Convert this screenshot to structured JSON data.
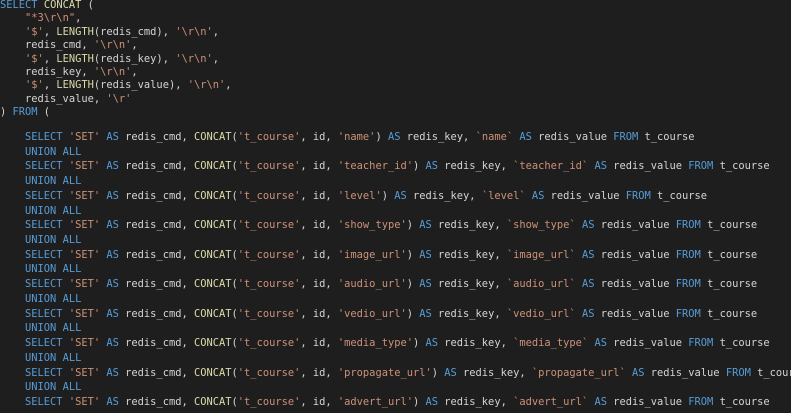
{
  "editor": {
    "language": "sql",
    "colors": {
      "background": "#1e1e1e",
      "keyword": "#569cd6",
      "function": "#dcdcaa",
      "string": "#ce9178",
      "identifier": "#d4d4d4"
    },
    "lines": [
      [
        [
          "kw",
          "SELECT"
        ],
        [
          "pn",
          " "
        ],
        [
          "fn",
          "CONCAT"
        ],
        [
          "pn",
          " ("
        ]
      ],
      [
        [
          "pn",
          "    "
        ],
        [
          "str",
          "\"*3\\r\\n\""
        ],
        [
          "pn",
          ","
        ]
      ],
      [
        [
          "pn",
          "    "
        ],
        [
          "str",
          "'$'"
        ],
        [
          "pn",
          ", "
        ],
        [
          "fn",
          "LENGTH"
        ],
        [
          "pn",
          "(redis_cmd), "
        ],
        [
          "str",
          "'\\r\\n'"
        ],
        [
          "pn",
          ","
        ]
      ],
      [
        [
          "pn",
          "    redis_cmd, "
        ],
        [
          "str",
          "'\\r\\n'"
        ],
        [
          "pn",
          ","
        ]
      ],
      [
        [
          "pn",
          "    "
        ],
        [
          "str",
          "'$'"
        ],
        [
          "pn",
          ", "
        ],
        [
          "fn",
          "LENGTH"
        ],
        [
          "pn",
          "(redis_key), "
        ],
        [
          "str",
          "'\\r\\n'"
        ],
        [
          "pn",
          ","
        ]
      ],
      [
        [
          "pn",
          "    redis_key, "
        ],
        [
          "str",
          "'\\r\\n'"
        ],
        [
          "pn",
          ","
        ]
      ],
      [
        [
          "pn",
          "    "
        ],
        [
          "str",
          "'$'"
        ],
        [
          "pn",
          ", "
        ],
        [
          "fn",
          "LENGTH"
        ],
        [
          "pn",
          "(redis_value), "
        ],
        [
          "str",
          "'\\r\\n'"
        ],
        [
          "pn",
          ","
        ]
      ],
      [
        [
          "pn",
          "    redis_value, "
        ],
        [
          "str",
          "'\\r'"
        ]
      ],
      [
        [
          "pn",
          ") "
        ],
        [
          "kw",
          "FROM"
        ],
        [
          "pn",
          " ("
        ]
      ],
      [
        [
          "pn",
          "    "
        ],
        [
          "kw",
          "SELECT"
        ],
        [
          "pn",
          " "
        ],
        [
          "str",
          "'SET'"
        ],
        [
          "pn",
          " "
        ],
        [
          "kw",
          "AS"
        ],
        [
          "pn",
          " redis_cmd, "
        ],
        [
          "fn",
          "CONCAT"
        ],
        [
          "pn",
          "("
        ],
        [
          "str",
          "'t_course'"
        ],
        [
          "pn",
          ", id, "
        ],
        [
          "str",
          "'name'"
        ],
        [
          "pn",
          ") "
        ],
        [
          "kw",
          "AS"
        ],
        [
          "pn",
          " redis_key, "
        ],
        [
          "str",
          "`name`"
        ],
        [
          "pn",
          " "
        ],
        [
          "kw",
          "AS"
        ],
        [
          "pn",
          " redis_value "
        ],
        [
          "kw",
          "FROM"
        ],
        [
          "pn",
          " t_course"
        ]
      ],
      [
        [
          "pn",
          "    "
        ],
        [
          "kw",
          "UNION ALL"
        ]
      ],
      [
        [
          "pn",
          "    "
        ],
        [
          "kw",
          "SELECT"
        ],
        [
          "pn",
          " "
        ],
        [
          "str",
          "'SET'"
        ],
        [
          "pn",
          " "
        ],
        [
          "kw",
          "AS"
        ],
        [
          "pn",
          " redis_cmd, "
        ],
        [
          "fn",
          "CONCAT"
        ],
        [
          "pn",
          "("
        ],
        [
          "str",
          "'t_course'"
        ],
        [
          "pn",
          ", id, "
        ],
        [
          "str",
          "'teacher_id'"
        ],
        [
          "pn",
          ") "
        ],
        [
          "kw",
          "AS"
        ],
        [
          "pn",
          " redis_key, "
        ],
        [
          "str",
          "`teacher_id`"
        ],
        [
          "pn",
          " "
        ],
        [
          "kw",
          "AS"
        ],
        [
          "pn",
          " redis_value "
        ],
        [
          "kw",
          "FROM"
        ],
        [
          "pn",
          " t_course"
        ]
      ],
      [
        [
          "pn",
          "    "
        ],
        [
          "kw",
          "UNION ALL"
        ]
      ],
      [
        [
          "pn",
          "    "
        ],
        [
          "kw",
          "SELECT"
        ],
        [
          "pn",
          " "
        ],
        [
          "str",
          "'SET'"
        ],
        [
          "pn",
          " "
        ],
        [
          "kw",
          "AS"
        ],
        [
          "pn",
          " redis_cmd, "
        ],
        [
          "fn",
          "CONCAT"
        ],
        [
          "pn",
          "("
        ],
        [
          "str",
          "'t_course'"
        ],
        [
          "pn",
          ", id, "
        ],
        [
          "str",
          "'level'"
        ],
        [
          "pn",
          ") "
        ],
        [
          "kw",
          "AS"
        ],
        [
          "pn",
          " redis_key, "
        ],
        [
          "str",
          "`level`"
        ],
        [
          "pn",
          " "
        ],
        [
          "kw",
          "AS"
        ],
        [
          "pn",
          " redis_value "
        ],
        [
          "kw",
          "FROM"
        ],
        [
          "pn",
          " t_course"
        ]
      ],
      [
        [
          "pn",
          "    "
        ],
        [
          "kw",
          "UNION ALL"
        ]
      ],
      [
        [
          "pn",
          "    "
        ],
        [
          "kw",
          "SELECT"
        ],
        [
          "pn",
          " "
        ],
        [
          "str",
          "'SET'"
        ],
        [
          "pn",
          " "
        ],
        [
          "kw",
          "AS"
        ],
        [
          "pn",
          " redis_cmd, "
        ],
        [
          "fn",
          "CONCAT"
        ],
        [
          "pn",
          "("
        ],
        [
          "str",
          "'t_course'"
        ],
        [
          "pn",
          ", id, "
        ],
        [
          "str",
          "'show_type'"
        ],
        [
          "pn",
          ") "
        ],
        [
          "kw",
          "AS"
        ],
        [
          "pn",
          " redis_key, "
        ],
        [
          "str",
          "`show_type`"
        ],
        [
          "pn",
          " "
        ],
        [
          "kw",
          "AS"
        ],
        [
          "pn",
          " redis_value "
        ],
        [
          "kw",
          "FROM"
        ],
        [
          "pn",
          " t_course"
        ]
      ],
      [
        [
          "pn",
          "    "
        ],
        [
          "kw",
          "UNION ALL"
        ]
      ],
      [
        [
          "pn",
          "    "
        ],
        [
          "kw",
          "SELECT"
        ],
        [
          "pn",
          " "
        ],
        [
          "str",
          "'SET'"
        ],
        [
          "pn",
          " "
        ],
        [
          "kw",
          "AS"
        ],
        [
          "pn",
          " redis_cmd, "
        ],
        [
          "fn",
          "CONCAT"
        ],
        [
          "pn",
          "("
        ],
        [
          "str",
          "'t_course'"
        ],
        [
          "pn",
          ", id, "
        ],
        [
          "str",
          "'image_url'"
        ],
        [
          "pn",
          ") "
        ],
        [
          "kw",
          "AS"
        ],
        [
          "pn",
          " redis_key, "
        ],
        [
          "str",
          "`image_url`"
        ],
        [
          "pn",
          " "
        ],
        [
          "kw",
          "AS"
        ],
        [
          "pn",
          " redis_value "
        ],
        [
          "kw",
          "FROM"
        ],
        [
          "pn",
          " t_course"
        ]
      ],
      [
        [
          "pn",
          "    "
        ],
        [
          "kw",
          "UNION ALL"
        ]
      ],
      [
        [
          "pn",
          "    "
        ],
        [
          "kw",
          "SELECT"
        ],
        [
          "pn",
          " "
        ],
        [
          "str",
          "'SET'"
        ],
        [
          "pn",
          " "
        ],
        [
          "kw",
          "AS"
        ],
        [
          "pn",
          " redis_cmd, "
        ],
        [
          "fn",
          "CONCAT"
        ],
        [
          "pn",
          "("
        ],
        [
          "str",
          "'t_course'"
        ],
        [
          "pn",
          ", id, "
        ],
        [
          "str",
          "'audio_url'"
        ],
        [
          "pn",
          ") "
        ],
        [
          "kw",
          "AS"
        ],
        [
          "pn",
          " redis_key, "
        ],
        [
          "str",
          "`audio_url`"
        ],
        [
          "pn",
          " "
        ],
        [
          "kw",
          "AS"
        ],
        [
          "pn",
          " redis_value "
        ],
        [
          "kw",
          "FROM"
        ],
        [
          "pn",
          " t_course"
        ]
      ],
      [
        [
          "pn",
          "    "
        ],
        [
          "kw",
          "UNION ALL"
        ]
      ],
      [
        [
          "pn",
          "    "
        ],
        [
          "kw",
          "SELECT"
        ],
        [
          "pn",
          " "
        ],
        [
          "str",
          "'SET'"
        ],
        [
          "pn",
          " "
        ],
        [
          "kw",
          "AS"
        ],
        [
          "pn",
          " redis_cmd, "
        ],
        [
          "fn",
          "CONCAT"
        ],
        [
          "pn",
          "("
        ],
        [
          "str",
          "'t_course'"
        ],
        [
          "pn",
          ", id, "
        ],
        [
          "str",
          "'vedio_url'"
        ],
        [
          "pn",
          ") "
        ],
        [
          "kw",
          "AS"
        ],
        [
          "pn",
          " redis_key, "
        ],
        [
          "str",
          "`vedio_url`"
        ],
        [
          "pn",
          " "
        ],
        [
          "kw",
          "AS"
        ],
        [
          "pn",
          " redis_value "
        ],
        [
          "kw",
          "FROM"
        ],
        [
          "pn",
          " t_course"
        ]
      ],
      [
        [
          "pn",
          "    "
        ],
        [
          "kw",
          "UNION ALL"
        ]
      ],
      [
        [
          "pn",
          "    "
        ],
        [
          "kw",
          "SELECT"
        ],
        [
          "pn",
          " "
        ],
        [
          "str",
          "'SET'"
        ],
        [
          "pn",
          " "
        ],
        [
          "kw",
          "AS"
        ],
        [
          "pn",
          " redis_cmd, "
        ],
        [
          "fn",
          "CONCAT"
        ],
        [
          "pn",
          "("
        ],
        [
          "str",
          "'t_course'"
        ],
        [
          "pn",
          ", id, "
        ],
        [
          "str",
          "'media_type'"
        ],
        [
          "pn",
          ") "
        ],
        [
          "kw",
          "AS"
        ],
        [
          "pn",
          " redis_key, "
        ],
        [
          "str",
          "`media_type`"
        ],
        [
          "pn",
          " "
        ],
        [
          "kw",
          "AS"
        ],
        [
          "pn",
          " redis_value "
        ],
        [
          "kw",
          "FROM"
        ],
        [
          "pn",
          " t_course"
        ]
      ],
      [
        [
          "pn",
          "    "
        ],
        [
          "kw",
          "UNION ALL"
        ]
      ],
      [
        [
          "pn",
          "    "
        ],
        [
          "kw",
          "SELECT"
        ],
        [
          "pn",
          " "
        ],
        [
          "str",
          "'SET'"
        ],
        [
          "pn",
          " "
        ],
        [
          "kw",
          "AS"
        ],
        [
          "pn",
          " redis_cmd, "
        ],
        [
          "fn",
          "CONCAT"
        ],
        [
          "pn",
          "("
        ],
        [
          "str",
          "'t_course'"
        ],
        [
          "pn",
          ", id, "
        ],
        [
          "str",
          "'propagate_url'"
        ],
        [
          "pn",
          ") "
        ],
        [
          "kw",
          "AS"
        ],
        [
          "pn",
          " redis_key, "
        ],
        [
          "str",
          "`propagate_url`"
        ],
        [
          "pn",
          " "
        ],
        [
          "kw",
          "AS"
        ],
        [
          "pn",
          " redis_value "
        ],
        [
          "kw",
          "FROM"
        ],
        [
          "pn",
          " t_course"
        ]
      ],
      [
        [
          "pn",
          "    "
        ],
        [
          "kw",
          "UNION ALL"
        ]
      ],
      [
        [
          "pn",
          "    "
        ],
        [
          "kw",
          "SELECT"
        ],
        [
          "pn",
          " "
        ],
        [
          "str",
          "'SET'"
        ],
        [
          "pn",
          " "
        ],
        [
          "kw",
          "AS"
        ],
        [
          "pn",
          " redis_cmd, "
        ],
        [
          "fn",
          "CONCAT"
        ],
        [
          "pn",
          "("
        ],
        [
          "str",
          "'t_course'"
        ],
        [
          "pn",
          ", id, "
        ],
        [
          "str",
          "'advert_url'"
        ],
        [
          "pn",
          ") "
        ],
        [
          "kw",
          "AS"
        ],
        [
          "pn",
          " redis_key, "
        ],
        [
          "str",
          "`advert_url`"
        ],
        [
          "pn",
          " "
        ],
        [
          "kw",
          "AS"
        ],
        [
          "pn",
          " redis_value "
        ],
        [
          "kw",
          "FROM"
        ],
        [
          "pn",
          " t_course"
        ]
      ]
    ]
  }
}
